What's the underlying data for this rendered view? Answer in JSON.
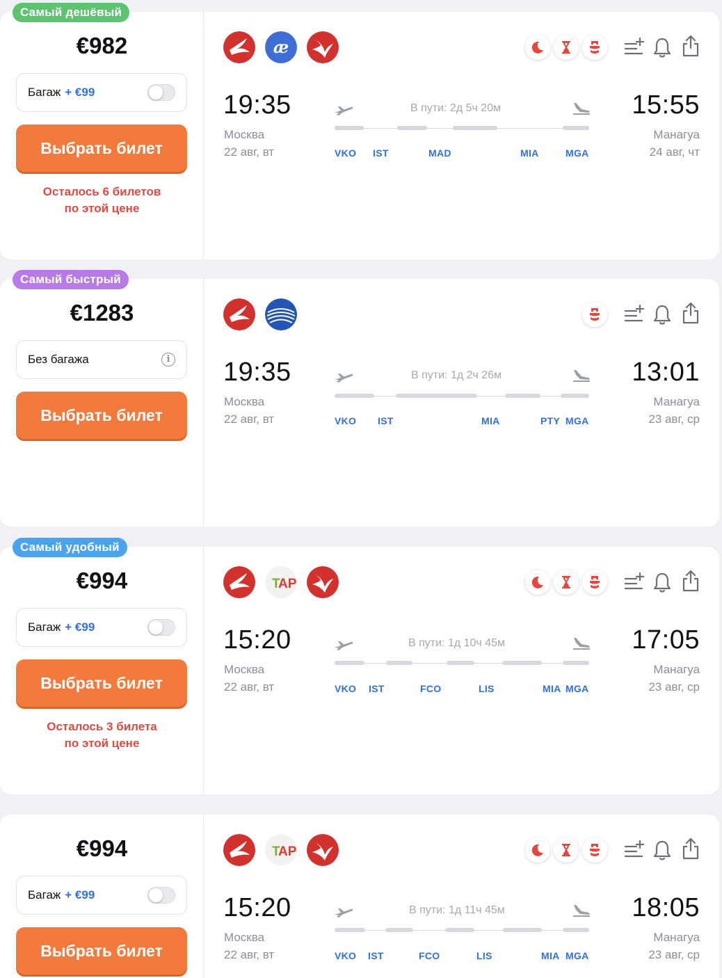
{
  "colors": {
    "accent": "#f27a3d",
    "link": "#2f6fe8",
    "warning": "#e4493f"
  },
  "tickets": [
    {
      "badge": "Самый дешёвый",
      "price": "€982",
      "baggage": {
        "label": "Багаж",
        "extra": "+ €99",
        "toggle": "off"
      },
      "buy_label": "Выбрать билет",
      "note_line1": "Осталось 6 билетов",
      "note_line2": "по этой цене",
      "airline_logos": [
        "turkish-airlines-logo",
        "air-europa-logo",
        "turkish-airlines-logo"
      ],
      "feature_icons": [
        "night-moon-icon",
        "hourglass-icon",
        "transfer-icon"
      ],
      "depart": {
        "time": "19:35",
        "city": "Москва",
        "date": "22 авг, вт"
      },
      "arrive": {
        "time": "15:55",
        "city": "Манагуа",
        "date": "24 авг, чт"
      },
      "duration": "В пути: 2д 5ч 20м",
      "airports": [
        "VKO",
        "IST",
        "MAD",
        "MIA",
        "MGA"
      ]
    },
    {
      "badge": "Самый быстрый",
      "price": "€1283",
      "baggage": {
        "label": "Без багажа",
        "info_icon": "info-icon"
      },
      "buy_label": "Выбрать билет",
      "airline_logos": [
        "turkish-airlines-logo",
        "copa-airlines-logo"
      ],
      "feature_icons": [
        "transfer-icon"
      ],
      "depart": {
        "time": "19:35",
        "city": "Москва",
        "date": "22 авг, вт"
      },
      "arrive": {
        "time": "13:01",
        "city": "Манагуа",
        "date": "23 авг, ср"
      },
      "duration": "В пути: 1д 2ч 26м",
      "airports": [
        "VKO",
        "IST",
        "MIA",
        "PTY",
        "MGA"
      ]
    },
    {
      "badge": "Самый удобный",
      "price": "€994",
      "baggage": {
        "label": "Багаж",
        "extra": "+ €99",
        "toggle": "off"
      },
      "buy_label": "Выбрать билет",
      "note_line1": "Осталось 3 билета",
      "note_line2": "по этой цене",
      "airline_logos": [
        "turkish-airlines-logo",
        "tap-portugal-logo",
        "turkish-airlines-logo"
      ],
      "feature_icons": [
        "night-moon-icon",
        "hourglass-icon",
        "transfer-icon"
      ],
      "depart": {
        "time": "15:20",
        "city": "Москва",
        "date": "22 авг, вт"
      },
      "arrive": {
        "time": "17:05",
        "city": "Манагуа",
        "date": "23 авг, ср"
      },
      "duration": "В пути: 1д 10ч 45м",
      "airports": [
        "VKO",
        "IST",
        "FCO",
        "LIS",
        "MIA",
        "MGA"
      ]
    },
    {
      "price": "€994",
      "baggage": {
        "label": "Багаж",
        "extra": "+ €99",
        "toggle": "off"
      },
      "buy_label": "Выбрать билет",
      "airline_logos": [
        "turkish-airlines-logo",
        "tap-portugal-logo",
        "turkish-airlines-logo"
      ],
      "feature_icons": [
        "night-moon-icon",
        "hourglass-icon",
        "transfer-icon"
      ],
      "depart": {
        "time": "15:20",
        "city": "Москва",
        "date": "22 авг, вт"
      },
      "arrive": {
        "time": "18:05",
        "city": "Манагуа",
        "date": "23 авг, ср"
      },
      "duration": "В пути: 1д 11ч 45м",
      "airports": [
        "VKO",
        "IST",
        "FCO",
        "LIS",
        "MIA",
        "MGA"
      ]
    }
  ],
  "action_icons": [
    "add-to-list-icon",
    "bell-icon",
    "share-icon"
  ]
}
